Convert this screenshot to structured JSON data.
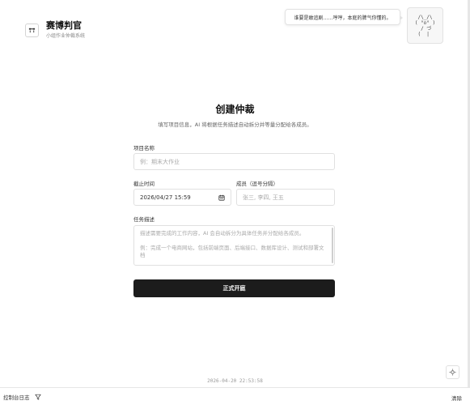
{
  "brand": {
    "title": "赛博判官",
    "subtitle": "小组作业仲裁系统",
    "logo_icon": "gavel-icon"
  },
  "mascot": {
    "speech": "谁要是敢追剧……哼哼，本庭的脾气你懂的。",
    "ascii": " /\\_/\\\n( °o° )\n  / づ\n (  |"
  },
  "form": {
    "title": "创建仲裁",
    "description": "填写项目信息，AI 将根据任务描述自动拆分并等量分配给各成员。",
    "project_name": {
      "label": "项目名称",
      "value": "",
      "placeholder": "例：期末大作业"
    },
    "deadline": {
      "label": "截止时间",
      "value": "2026/04/27 15:59",
      "icon": "calendar-icon"
    },
    "members": {
      "label": "成员（逗号分隔）",
      "value": "",
      "placeholder": "张三, 李四, 王五"
    },
    "task": {
      "label": "任务描述",
      "value": "",
      "placeholder_line1": "描述需要完成的工作内容，AI 会自动拆分为具体任务并分配给各成员。",
      "placeholder_line2": "例：完成一个电商网站，包括前端页面、后端接口、数据库设计、测试和部署文档"
    },
    "submit_label": "正式开庭"
  },
  "timestamp": "2026-04-20 22:53:58",
  "floating_button_icon": "sun-icon",
  "console": {
    "label": "控制台日志",
    "filter_icon": "filter-icon",
    "clear_label": "清除"
  }
}
